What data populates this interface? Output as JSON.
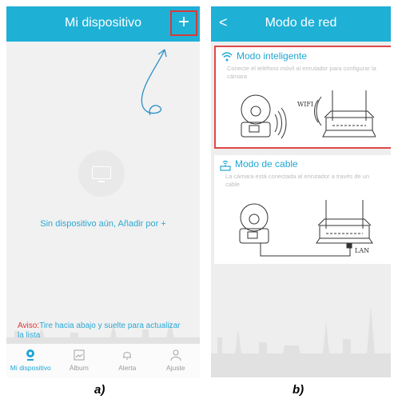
{
  "left_screen": {
    "header_title": "Mi dispositivo",
    "add_label": "+",
    "empty_message": "Sin dispositivo aún, Añadir por +",
    "notice_prefix": "Aviso:",
    "notice_text": "Tire hacia abajo y suelte para actualizar la lista",
    "tabs": [
      "Mi dispositivo",
      "Álbum",
      "Alerta",
      "Ajuste"
    ]
  },
  "right_screen": {
    "back_label": "<",
    "header_title": "Modo de red",
    "wifi_mode": {
      "title": "Modo inteligente",
      "description": "Conecte el teléfono móvil al enrutador para configurar la cámara",
      "illustration_label": "WIFI"
    },
    "cable_mode": {
      "title": "Modo de cable",
      "description": "La cámara está conectada al enrutador a través de un cable",
      "illustration_label": "LAN"
    }
  },
  "captions": [
    "a)",
    "b)"
  ],
  "colors": {
    "accent": "#1fb0d6",
    "highlight": "#e04848",
    "warning": "#e53030"
  }
}
